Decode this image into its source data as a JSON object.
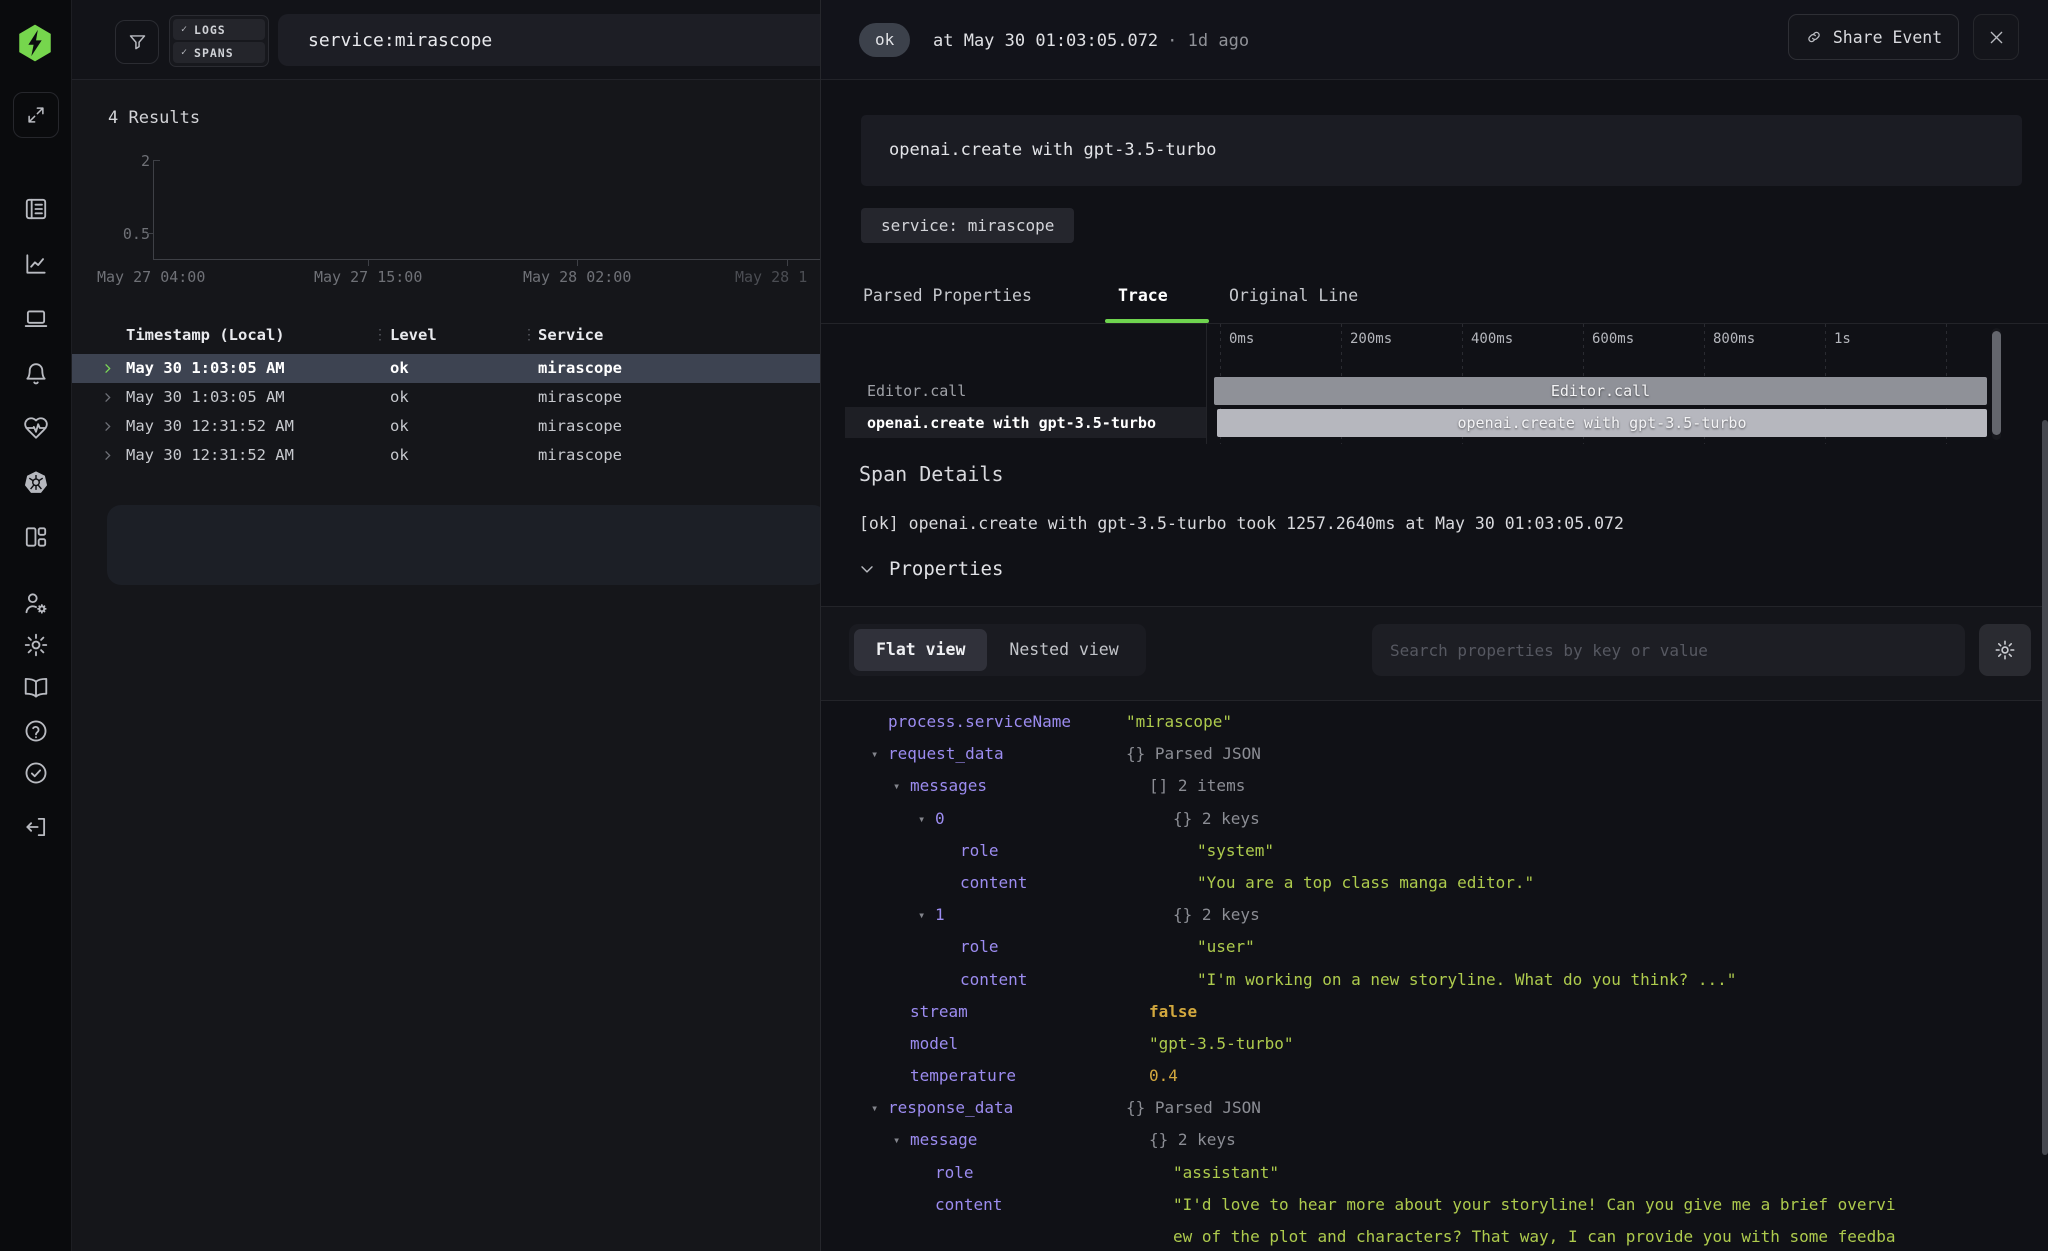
{
  "sidebar": {
    "icons": [
      "lightning-logo",
      "expand",
      "notebook-logs",
      "line-chart",
      "laptop",
      "bell",
      "heart-pulse",
      "kubernetes",
      "layout-panels",
      "user-gear",
      "settings-gear",
      "open-book",
      "help-circle",
      "check-circle",
      "logout"
    ],
    "accent_color": "#76d64d"
  },
  "topbar": {
    "check": "✓",
    "logs_label": "LOGS",
    "spans_label": "SPANS",
    "query": "service:mirascope"
  },
  "results": {
    "count_label": "4 Results",
    "chart": {
      "type": "bar",
      "title": "4 Results",
      "y_ticks": [
        "2",
        "0.5"
      ],
      "x_ticks": [
        "May 27 04:00",
        "May 27 15:00",
        "May 28 02:00",
        "May 28 1"
      ],
      "values_visible": []
    },
    "table": {
      "handle_glyph": "⋮",
      "headers": [
        "Timestamp (Local)",
        "Level",
        "Service"
      ],
      "rows": [
        {
          "timestamp": "May 30 1:03:05 AM",
          "level": "ok",
          "service": "mirascope",
          "selected": true
        },
        {
          "timestamp": "May 30 1:03:05 AM",
          "level": "ok",
          "service": "mirascope",
          "selected": false
        },
        {
          "timestamp": "May 30 12:31:52 AM",
          "level": "ok",
          "service": "mirascope",
          "selected": false
        },
        {
          "timestamp": "May 30 12:31:52 AM",
          "level": "ok",
          "service": "mirascope",
          "selected": false
        }
      ]
    }
  },
  "detail": {
    "status": "ok",
    "time": "at May 30 01:03:05.072",
    "ago": "· 1d ago",
    "share_label": "Share Event",
    "message": "openai.create with gpt-3.5-turbo",
    "chip": "service: mirascope",
    "tabs": [
      {
        "label": "Parsed Properties",
        "active": false
      },
      {
        "label": "Trace",
        "active": true
      },
      {
        "label": "Original Line",
        "active": false
      }
    ],
    "trace": {
      "ruler": [
        "0ms",
        "200ms",
        "400ms",
        "600ms",
        "800ms",
        "1s"
      ],
      "spans": [
        {
          "name": "Editor.call",
          "selected": false,
          "bar_color": "#8f9198"
        },
        {
          "name": "openai.create with gpt-3.5-turbo",
          "selected": true,
          "bar_color": "#b6b7be"
        }
      ]
    },
    "span_details": {
      "title": "Span Details",
      "summary": "[ok] openai.create with gpt-3.5-turbo took 1257.2640ms at May 30 01:03:05.072",
      "section": "Properties"
    },
    "toolbar": {
      "flat_label": "Flat view",
      "nested_label": "Nested view",
      "search_placeholder": "Search properties by key or value"
    },
    "properties": {
      "caret_glyph": "▾",
      "rows": [
        {
          "indent": 0,
          "caret": false,
          "key": "process.serviceName",
          "value": "\"mirascope\"",
          "type": "str"
        },
        {
          "indent": 0,
          "caret": true,
          "key": "request_data",
          "value": "{} Parsed JSON",
          "type": "meta"
        },
        {
          "indent": 1,
          "caret": true,
          "key": "messages",
          "value": "[] 2 items",
          "type": "meta"
        },
        {
          "indent": 2,
          "caret": true,
          "key": "0",
          "value": "{} 2 keys",
          "type": "meta"
        },
        {
          "indent": 3,
          "caret": false,
          "key": "role",
          "value": "\"system\"",
          "type": "str"
        },
        {
          "indent": 3,
          "caret": false,
          "key": "content",
          "value": "\"You are a top class manga editor.\"",
          "type": "str"
        },
        {
          "indent": 2,
          "caret": true,
          "key": "1",
          "value": "{} 2 keys",
          "type": "meta"
        },
        {
          "indent": 3,
          "caret": false,
          "key": "role",
          "value": "\"user\"",
          "type": "str"
        },
        {
          "indent": 3,
          "caret": false,
          "key": "content",
          "value": "\"I'm working on a new storyline. What do you think? ...\"",
          "type": "str"
        },
        {
          "indent": 1,
          "caret": false,
          "key": "stream",
          "value": "false",
          "type": "bool"
        },
        {
          "indent": 1,
          "caret": false,
          "key": "model",
          "value": "\"gpt-3.5-turbo\"",
          "type": "str"
        },
        {
          "indent": 1,
          "caret": false,
          "key": "temperature",
          "value": "0.4",
          "type": "num"
        },
        {
          "indent": 0,
          "caret": true,
          "key": "response_data",
          "value": "{} Parsed JSON",
          "type": "meta"
        },
        {
          "indent": 1,
          "caret": true,
          "key": "message",
          "value": "{} 2 keys",
          "type": "meta"
        },
        {
          "indent": 2,
          "caret": false,
          "key": "role",
          "value": "\"assistant\"",
          "type": "str"
        },
        {
          "indent": 2,
          "caret": false,
          "key": "content",
          "value": "\"I'd love to hear more about your storyline! Can you give me a brief overvi\new of the plot and characters? That way, I can provide you with some feedba",
          "type": "str",
          "wrap": true
        }
      ]
    }
  }
}
